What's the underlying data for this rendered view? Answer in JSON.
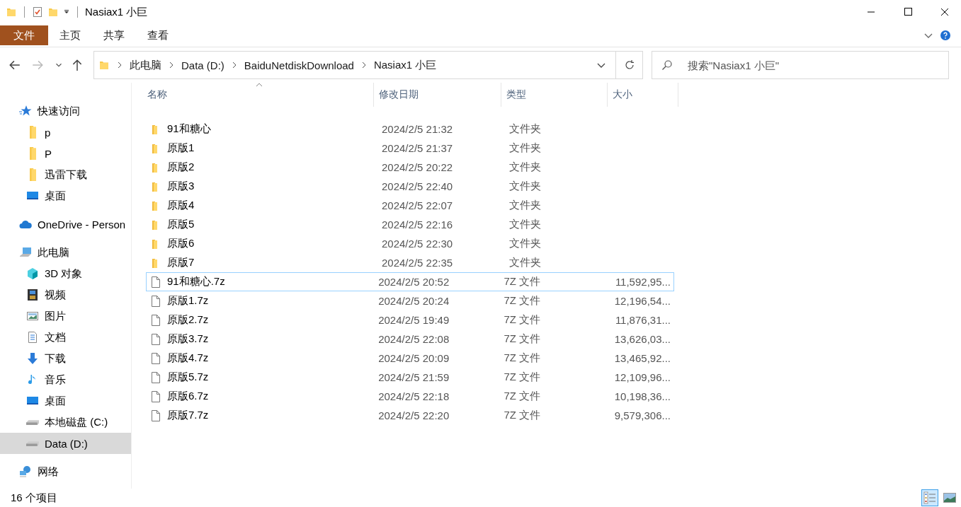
{
  "window": {
    "title": "Nasiax1 小巨"
  },
  "ribbon_tabs": [
    {
      "label": "文件",
      "kind": "file"
    },
    {
      "label": "主页",
      "kind": "tab"
    },
    {
      "label": "共享",
      "kind": "tab"
    },
    {
      "label": "查看",
      "kind": "tab"
    }
  ],
  "breadcrumb": [
    "此电脑",
    "Data (D:)",
    "BaiduNetdiskDownload",
    "Nasiax1 小巨"
  ],
  "search": {
    "placeholder": "搜索\"Nasiax1 小巨\""
  },
  "sidebar": {
    "items": [
      {
        "label": "快速访问",
        "kind": "star",
        "selected": false,
        "children": [
          {
            "label": "p",
            "kind": "folder",
            "selected": false
          },
          {
            "label": "P",
            "kind": "folder",
            "selected": false
          },
          {
            "label": "迅雷下载",
            "kind": "folder",
            "selected": false
          },
          {
            "label": "桌面",
            "kind": "desktop",
            "selected": false
          }
        ]
      },
      {
        "label": "OneDrive - Person",
        "kind": "cloud",
        "selected": false
      },
      {
        "label": "此电脑",
        "kind": "pc",
        "selected": false,
        "children": [
          {
            "label": "3D 对象",
            "kind": "cube",
            "selected": false
          },
          {
            "label": "视频",
            "kind": "film",
            "selected": false
          },
          {
            "label": "图片",
            "kind": "picture",
            "selected": false
          },
          {
            "label": "文档",
            "kind": "document",
            "selected": false
          },
          {
            "label": "下载",
            "kind": "download",
            "selected": false
          },
          {
            "label": "音乐",
            "kind": "music",
            "selected": false
          },
          {
            "label": "桌面",
            "kind": "desktop",
            "selected": false
          },
          {
            "label": "本地磁盘 (C:)",
            "kind": "drive",
            "selected": false
          },
          {
            "label": "Data (D:)",
            "kind": "drive",
            "selected": true
          }
        ]
      },
      {
        "label": "网络",
        "kind": "network",
        "selected": false
      }
    ]
  },
  "table": {
    "columns": [
      "名称",
      "修改日期",
      "类型",
      "大小"
    ],
    "rows": [
      {
        "name": "91和糖心",
        "date": "2024/2/5 21:32",
        "type": "文件夹",
        "kind": "folder",
        "focused": false
      },
      {
        "name": "原版1",
        "date": "2024/2/5 21:37",
        "type": "文件夹",
        "kind": "folder",
        "focused": false
      },
      {
        "name": "原版2",
        "date": "2024/2/5 20:22",
        "type": "文件夹",
        "kind": "folder",
        "focused": false
      },
      {
        "name": "原版3",
        "date": "2024/2/5 22:40",
        "type": "文件夹",
        "kind": "folder",
        "focused": false
      },
      {
        "name": "原版4",
        "date": "2024/2/5 22:07",
        "type": "文件夹",
        "kind": "folder",
        "focused": false
      },
      {
        "name": "原版5",
        "date": "2024/2/5 22:16",
        "type": "文件夹",
        "kind": "folder",
        "focused": false
      },
      {
        "name": "原版6",
        "date": "2024/2/5 22:30",
        "type": "文件夹",
        "kind": "folder",
        "focused": false
      },
      {
        "name": "原版7",
        "date": "2024/2/5 22:35",
        "type": "文件夹",
        "kind": "folder",
        "focused": false
      },
      {
        "name": "91和糖心.7z",
        "date": "2024/2/5 20:52",
        "type": "7Z 文件",
        "size": "11,592,95...",
        "kind": "file",
        "focused": true
      },
      {
        "name": "原版1.7z",
        "date": "2024/2/5 20:24",
        "type": "7Z 文件",
        "size": "12,196,54...",
        "kind": "file",
        "focused": false
      },
      {
        "name": "原版2.7z",
        "date": "2024/2/5 19:49",
        "type": "7Z 文件",
        "size": "11,876,31...",
        "kind": "file",
        "focused": false
      },
      {
        "name": "原版3.7z",
        "date": "2024/2/5 22:08",
        "type": "7Z 文件",
        "size": "13,626,03...",
        "kind": "file",
        "focused": false
      },
      {
        "name": "原版4.7z",
        "date": "2024/2/5 20:09",
        "type": "7Z 文件",
        "size": "13,465,92...",
        "kind": "file",
        "focused": false
      },
      {
        "name": "原版5.7z",
        "date": "2024/2/5 21:59",
        "type": "7Z 文件",
        "size": "12,109,96...",
        "kind": "file",
        "focused": false
      },
      {
        "name": "原版6.7z",
        "date": "2024/2/5 22:18",
        "type": "7Z 文件",
        "size": "10,198,36...",
        "kind": "file",
        "focused": false
      },
      {
        "name": "原版7.7z",
        "date": "2024/2/5 22:20",
        "type": "7Z 文件",
        "size": "9,579,306...",
        "kind": "file",
        "focused": false
      }
    ]
  },
  "status_bar": {
    "text": "16 个项目",
    "views": [
      {
        "kind": "details",
        "selected": true
      },
      {
        "kind": "large",
        "selected": false
      }
    ]
  }
}
